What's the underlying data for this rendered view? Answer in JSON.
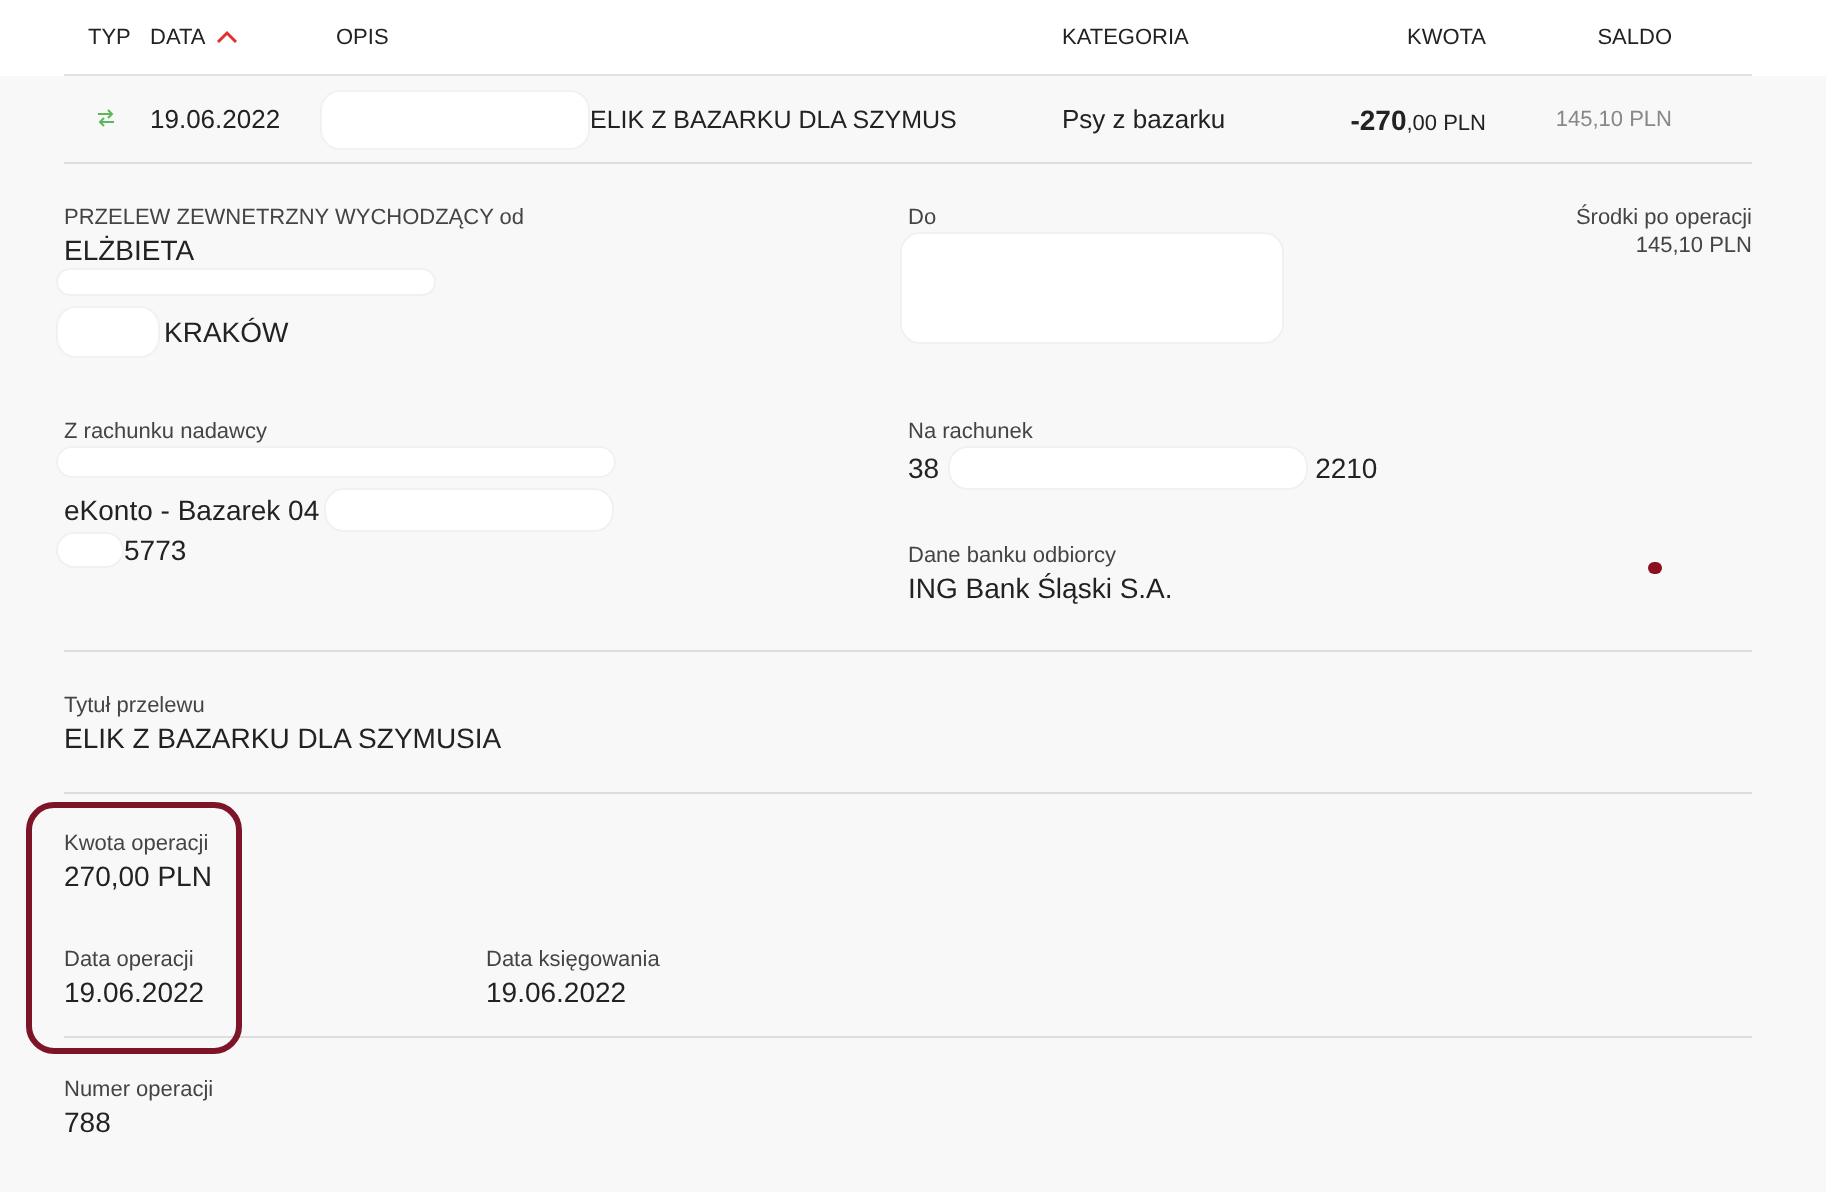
{
  "table": {
    "columns": [
      {
        "label": "TYP",
        "sorted": false
      },
      {
        "label": "DATA",
        "sorted": true
      },
      {
        "label": "OPIS",
        "sorted": false
      },
      {
        "label": "KATEGORIA",
        "sorted": false
      },
      {
        "label": "KWOTA",
        "sorted": false
      },
      {
        "label": "SALDO",
        "sorted": false
      }
    ],
    "rows": [
      {
        "date": "19.06.2022",
        "description": "ELIK Z BAZARKU DLA SZYMUS",
        "category": "Psy z bazarku",
        "amount_whole": "-270",
        "amount_fraction": ",00 PLN",
        "balance": "145,10 PLN"
      }
    ]
  },
  "details": {
    "type_label": "PRZELEW ZEWNETRZNY WYCHODZĄCY od",
    "sender_name": "ELŻBIETA",
    "sender_city": "KRAKÓW",
    "recipient_label": "Do",
    "balance_after_label": "Środki po operacji",
    "balance_after": "145,10 PLN",
    "from_account_label": "Z rachunku nadawcy",
    "from_account_name": "eKonto - Bazarek 04",
    "from_account_end": "5773",
    "to_account_label": "Na rachunek",
    "to_account_start": "38",
    "to_account_end": "2210",
    "bank_label": "Dane banku odbiorcy",
    "bank_name": "ING Bank Śląski S.A.",
    "title_label": "Tytuł przelewu",
    "title": "ELIK Z BAZARKU DLA SZYMUSIA",
    "amount_label": "Kwota operacji",
    "amount": "270,00 PLN",
    "operation_date_label": "Data operacji",
    "operation_date": "19.06.2022",
    "posting_date_label": "Data księgowania",
    "posting_date": "19.06.2022",
    "number_label": "Numer operacji",
    "number": "788"
  }
}
